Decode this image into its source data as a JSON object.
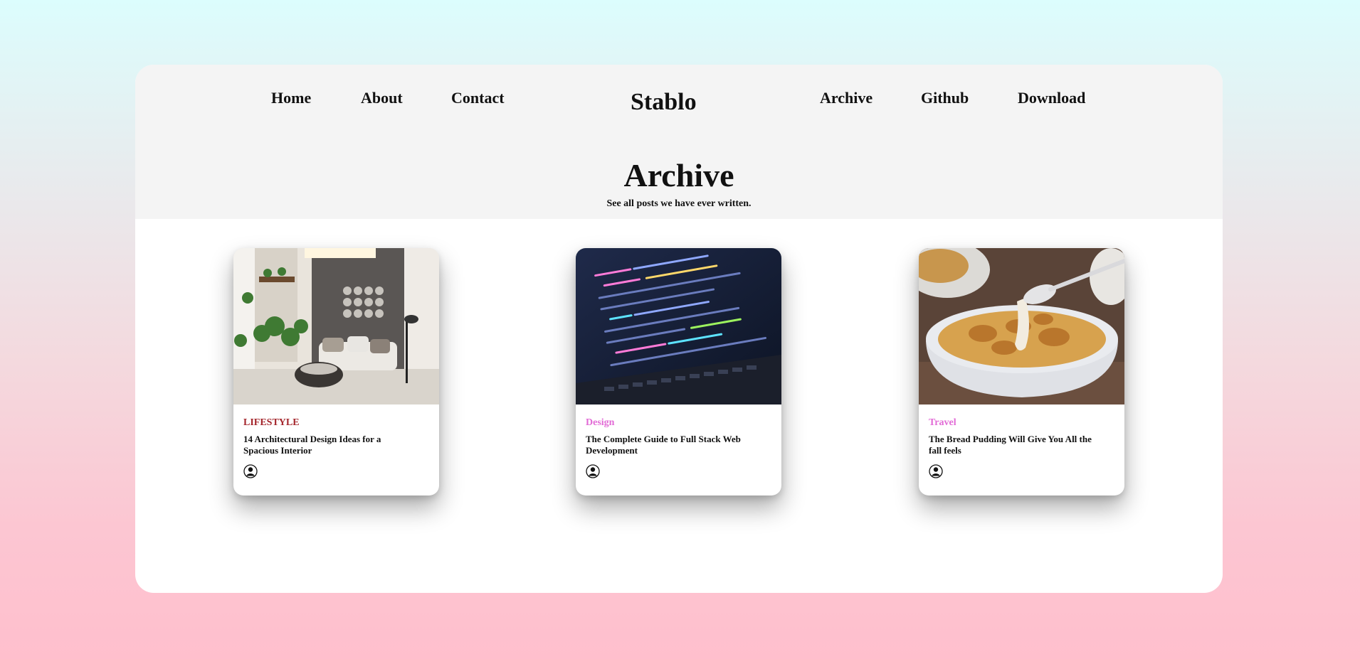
{
  "nav": {
    "left": [
      "Home",
      "About",
      "Contact"
    ],
    "brand": "Stablo",
    "right": [
      "Archive",
      "Github",
      "Download"
    ]
  },
  "hero": {
    "title": "Archive",
    "subtitle": "See all posts we have ever written."
  },
  "posts": [
    {
      "category": "LIFESTYLE",
      "category_color": "#a4262c",
      "title": "14 Architectural Design Ideas for a Spacious Interior",
      "image": "interior-living-room-photo"
    },
    {
      "category": "Design",
      "category_color": "#e26bd6",
      "title": "The Complete Guide to Full Stack Web Development",
      "image": "code-on-laptop-photo"
    },
    {
      "category": "Travel",
      "category_color": "#e26bd6",
      "title": "The Bread Pudding Will Give You All the fall feels",
      "image": "bread-pudding-photo"
    }
  ],
  "colors": {
    "lifestyle": "#a4262c",
    "design": "#e26bd6",
    "travel": "#e26bd6"
  }
}
